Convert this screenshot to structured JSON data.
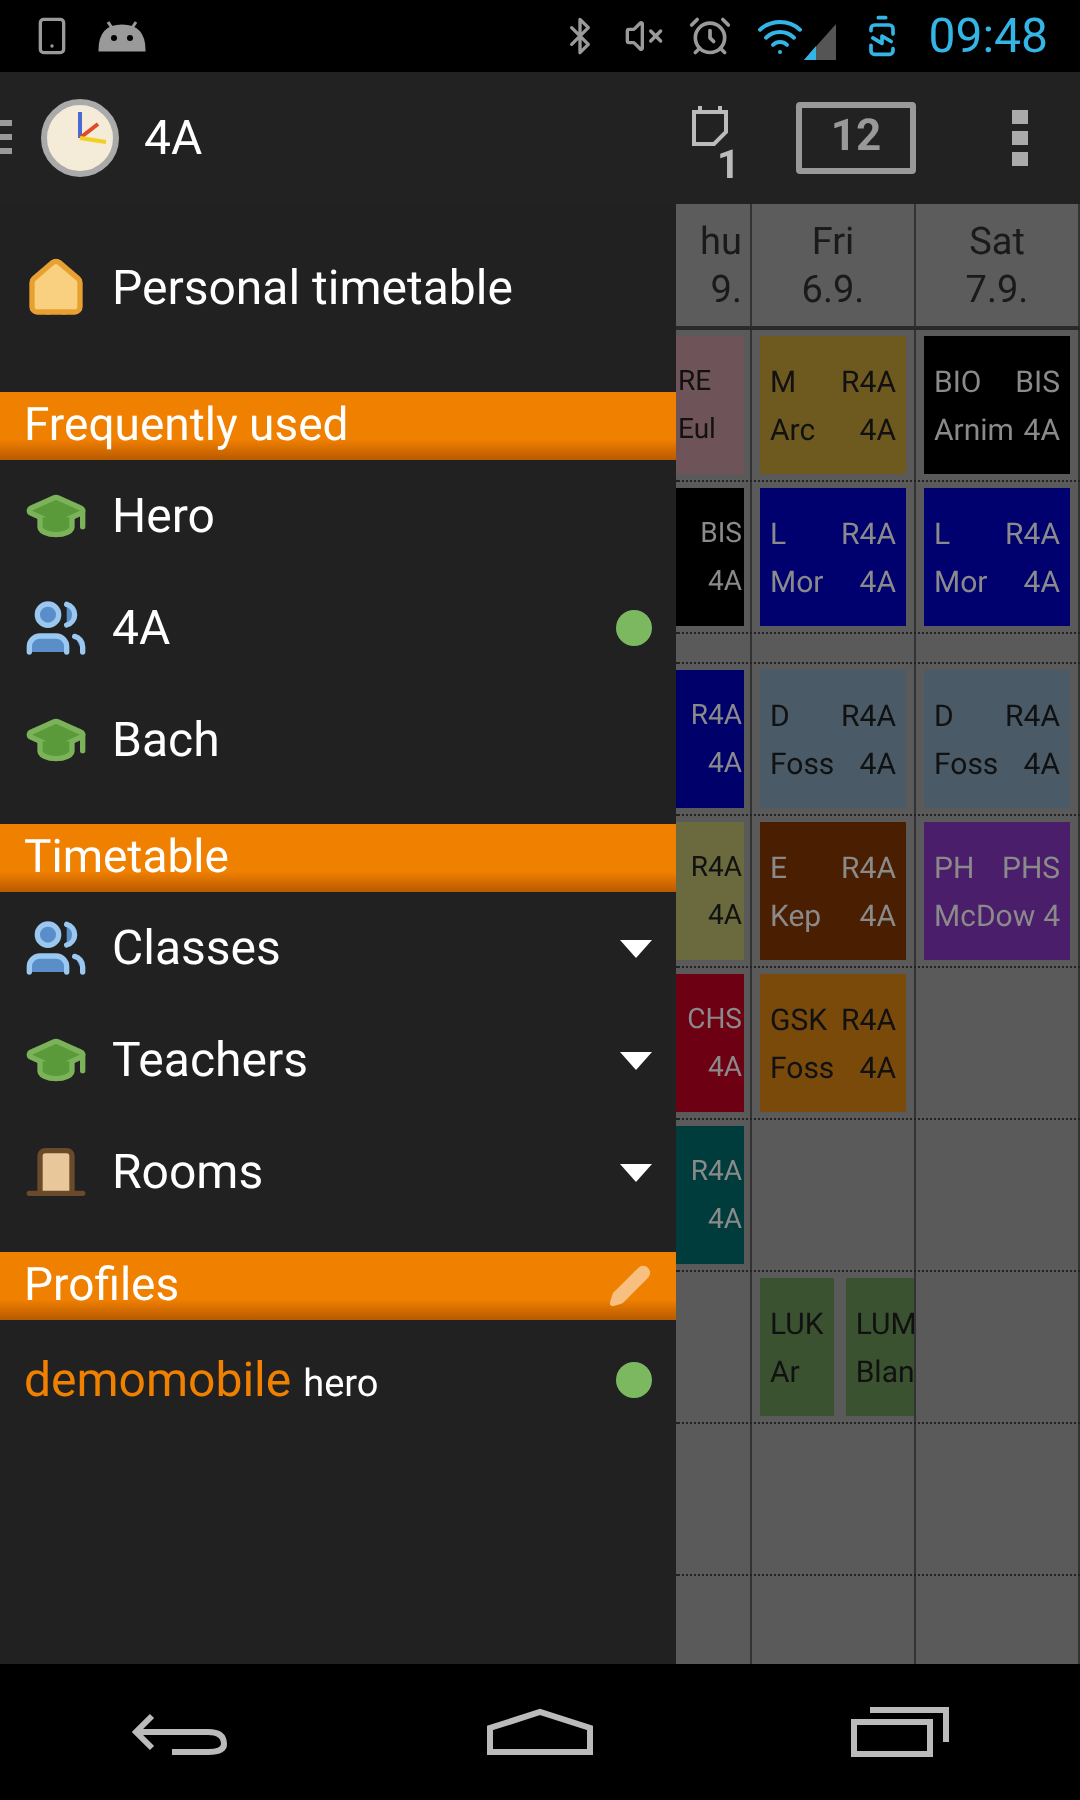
{
  "status_bar": {
    "time": "09:48"
  },
  "action_bar": {
    "title": "4A",
    "notes_count": "1",
    "calendar_day": "12"
  },
  "drawer": {
    "personal": {
      "label": "Personal timetable"
    },
    "sections": [
      {
        "title": "Frequently used",
        "editable": false,
        "items": [
          {
            "kind": "teacher",
            "label": "Hero",
            "current": false,
            "expandable": false
          },
          {
            "kind": "class",
            "label": "4A",
            "current": true,
            "expandable": false
          },
          {
            "kind": "teacher",
            "label": "Bach",
            "current": false,
            "expandable": false
          }
        ]
      },
      {
        "title": "Timetable",
        "editable": false,
        "items": [
          {
            "kind": "class",
            "label": "Classes",
            "current": false,
            "expandable": true
          },
          {
            "kind": "teacher",
            "label": "Teachers",
            "current": false,
            "expandable": true
          },
          {
            "kind": "room",
            "label": "Rooms",
            "current": false,
            "expandable": true
          }
        ]
      },
      {
        "title": "Profiles",
        "editable": true,
        "items": [
          {
            "kind": "profile",
            "label": "demomobile",
            "user": "hero",
            "current": true,
            "expandable": false
          }
        ]
      }
    ]
  },
  "timetable": {
    "days": [
      {
        "name": "hu",
        "date": "9."
      },
      {
        "name": "Fri",
        "date": "6.9."
      },
      {
        "name": "Sat",
        "date": "7.9."
      }
    ],
    "rows": [
      {
        "kind": "lesson",
        "cells": [
          [
            {
              "subject": "RE",
              "teacher": "Eul",
              "color": "#6e5458"
            }
          ],
          [
            {
              "subject": "M",
              "room": "R4A",
              "teacher": "Arc",
              "class": "4A",
              "color": "#6e5a1e"
            }
          ],
          [
            {
              "subject": "BIO",
              "room": "BIS",
              "teacher": "Arnim",
              "class": "4A",
              "color": "#000000"
            }
          ]
        ]
      },
      {
        "kind": "lesson",
        "cells": [
          [
            {
              "room": "BIS",
              "class": "4A",
              "color": "#000000"
            }
          ],
          [
            {
              "subject": "L",
              "room": "R4A",
              "teacher": "Mor",
              "class": "4A",
              "color": "#00006e"
            }
          ],
          [
            {
              "subject": "L",
              "room": "R4A",
              "teacher": "Mor",
              "class": "4A",
              "color": "#00006e"
            }
          ]
        ]
      },
      {
        "kind": "break",
        "cells": [
          [],
          [],
          []
        ]
      },
      {
        "kind": "lesson",
        "cells": [
          [
            {
              "room": "R4A",
              "class": "4A",
              "color": "#00006a"
            }
          ],
          [
            {
              "subject": "D",
              "room": "R4A",
              "teacher": "Foss",
              "class": "4A",
              "color": "#4a5a66"
            }
          ],
          [
            {
              "subject": "D",
              "room": "R4A",
              "teacher": "Foss",
              "class": "4A",
              "color": "#4a5a66"
            }
          ]
        ]
      },
      {
        "kind": "lesson",
        "cells": [
          [
            {
              "room": "R4A",
              "class": "4A",
              "color": "#6a6a3e"
            }
          ],
          [
            {
              "subject": "E",
              "room": "R4A",
              "teacher": "Kep",
              "class": "4A",
              "color": "#4a1e00"
            }
          ],
          [
            {
              "subject": "PH",
              "room": "PHS",
              "teacher": "McDow",
              "class": "4",
              "color": "#4a1e6a"
            }
          ]
        ]
      },
      {
        "kind": "lesson",
        "cells": [
          [
            {
              "room": "CHS",
              "class": "4A",
              "color": "#6e0014"
            }
          ],
          [
            {
              "subject": "GSK",
              "room": "R4A",
              "teacher": "Foss",
              "class": "4A",
              "color": "#7a4a0a"
            }
          ],
          []
        ]
      },
      {
        "kind": "lesson",
        "cells": [
          [
            {
              "room": "R4A",
              "class": "4A",
              "color": "#003c3c"
            }
          ],
          [],
          []
        ]
      },
      {
        "kind": "lesson",
        "cells": [
          [],
          [
            {
              "subject": "LUK",
              "teacher": "Ar",
              "color": "#3a5230"
            },
            {
              "subject": "LUM",
              "teacher": "Blan",
              "color": "#3a5230"
            }
          ],
          []
        ]
      },
      {
        "kind": "lesson",
        "cells": [
          [],
          [],
          []
        ]
      },
      {
        "kind": "lesson",
        "cells": [
          [],
          [],
          []
        ]
      }
    ]
  }
}
